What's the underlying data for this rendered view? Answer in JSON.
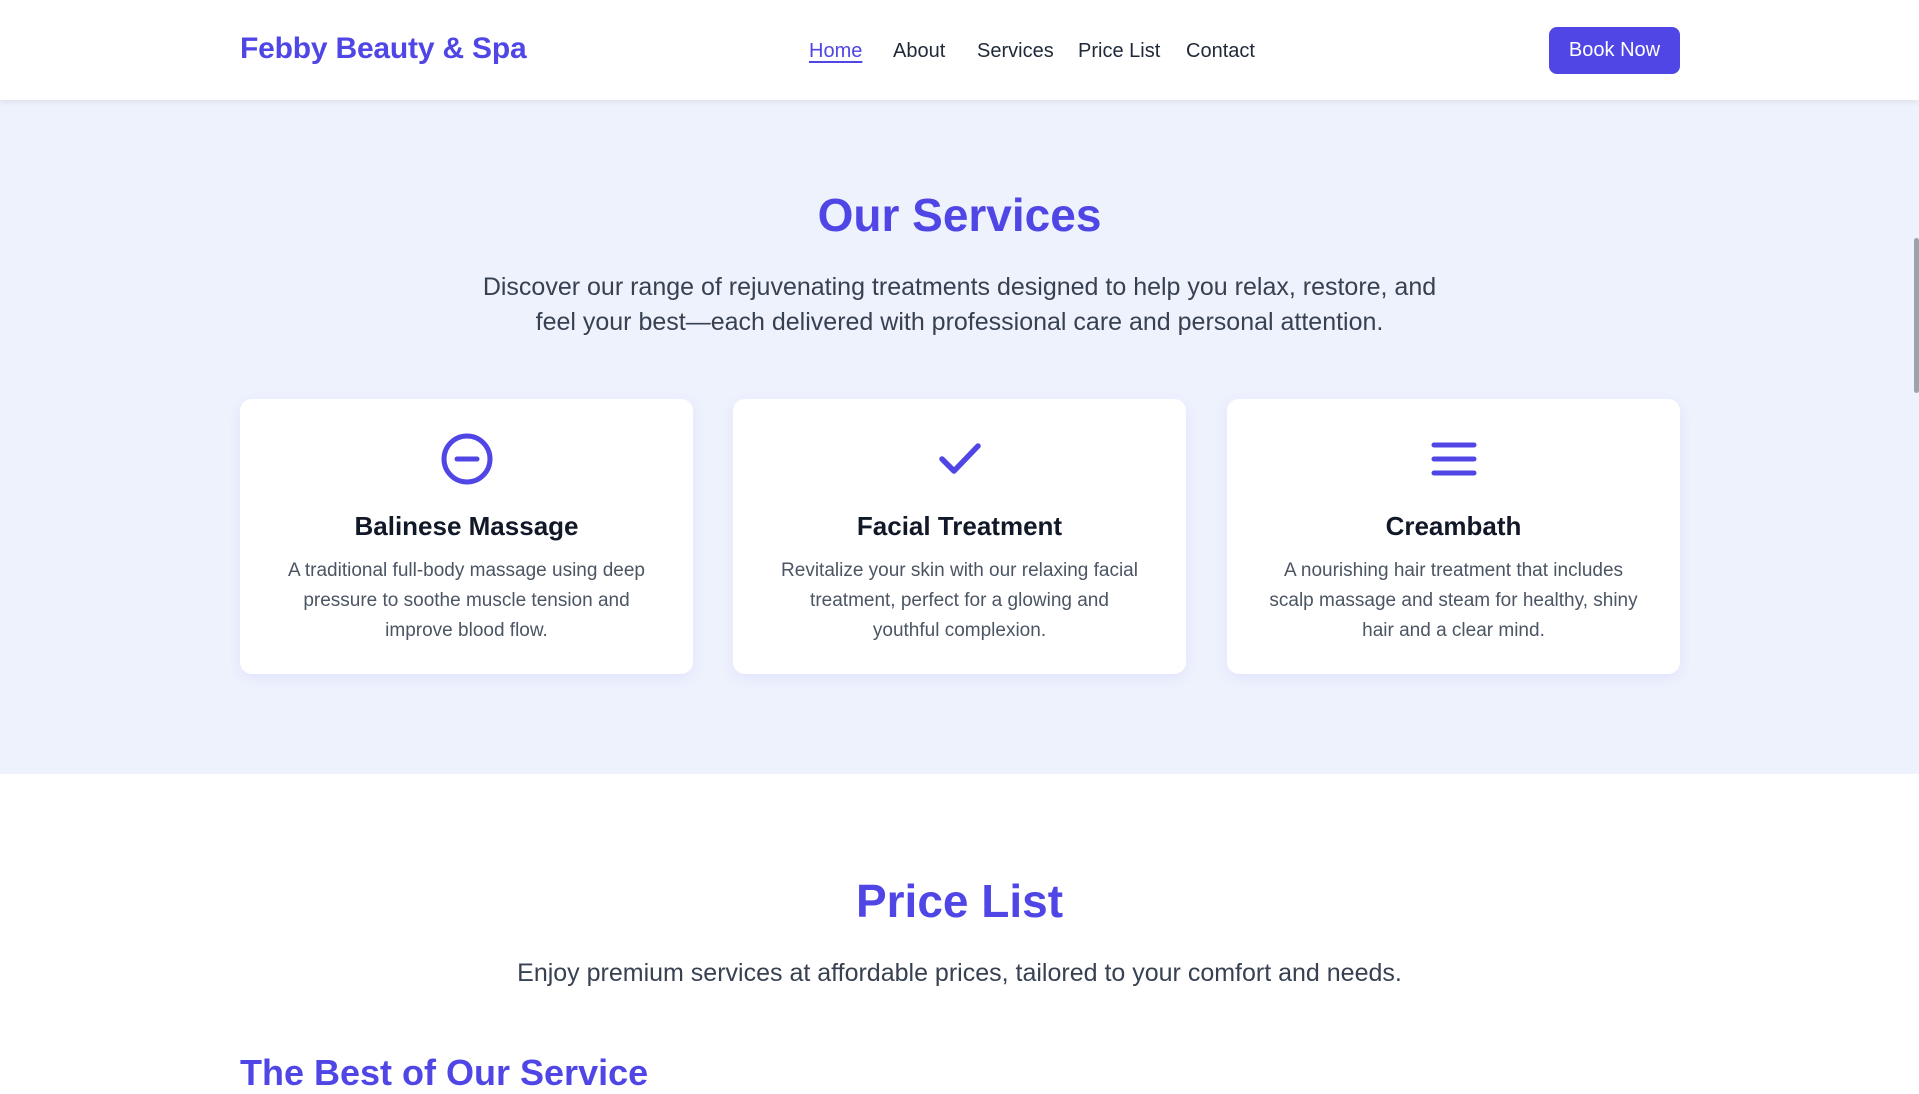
{
  "brand": {
    "name": "Febby Beauty & Spa"
  },
  "nav": {
    "items": [
      "Home",
      "About",
      "Services",
      "Price List",
      "Contact"
    ],
    "active": "Home"
  },
  "header": {
    "book_label": "Book Now"
  },
  "services": {
    "title": "Our Services",
    "subtitle_line1": "Discover our range of rejuvenating treatments designed to help you relax, restore, and",
    "subtitle_line2": "feel your best—each delivered with professional care and personal attention.",
    "cards": [
      {
        "icon": "minus-circle-icon",
        "title": "Balinese Massage",
        "desc_line1": "A traditional full-body massage using deep",
        "desc_line2": "pressure to soothe muscle tension and",
        "desc_line3": "improve blood flow."
      },
      {
        "icon": "check-icon",
        "title": "Facial Treatment",
        "desc_line1": "Revitalize your skin with our relaxing facial",
        "desc_line2": "treatment, perfect for a glowing and",
        "desc_line3": "youthful complexion."
      },
      {
        "icon": "menu-lines-icon",
        "title": "Creambath",
        "desc_line1": "A nourishing hair treatment that includes",
        "desc_line2": "scalp massage and steam for healthy, shiny",
        "desc_line3": "hair and a clear mind."
      }
    ]
  },
  "price": {
    "title": "Price List",
    "subtitle": "Enjoy premium services at affordable prices, tailored to your comfort and needs.",
    "subheading": "The Best of Our Service"
  },
  "colors": {
    "accent": "#4f46e5",
    "services_bg": "#eef2fd",
    "text_dark": "#111827",
    "text_muted": "#4b5563"
  }
}
